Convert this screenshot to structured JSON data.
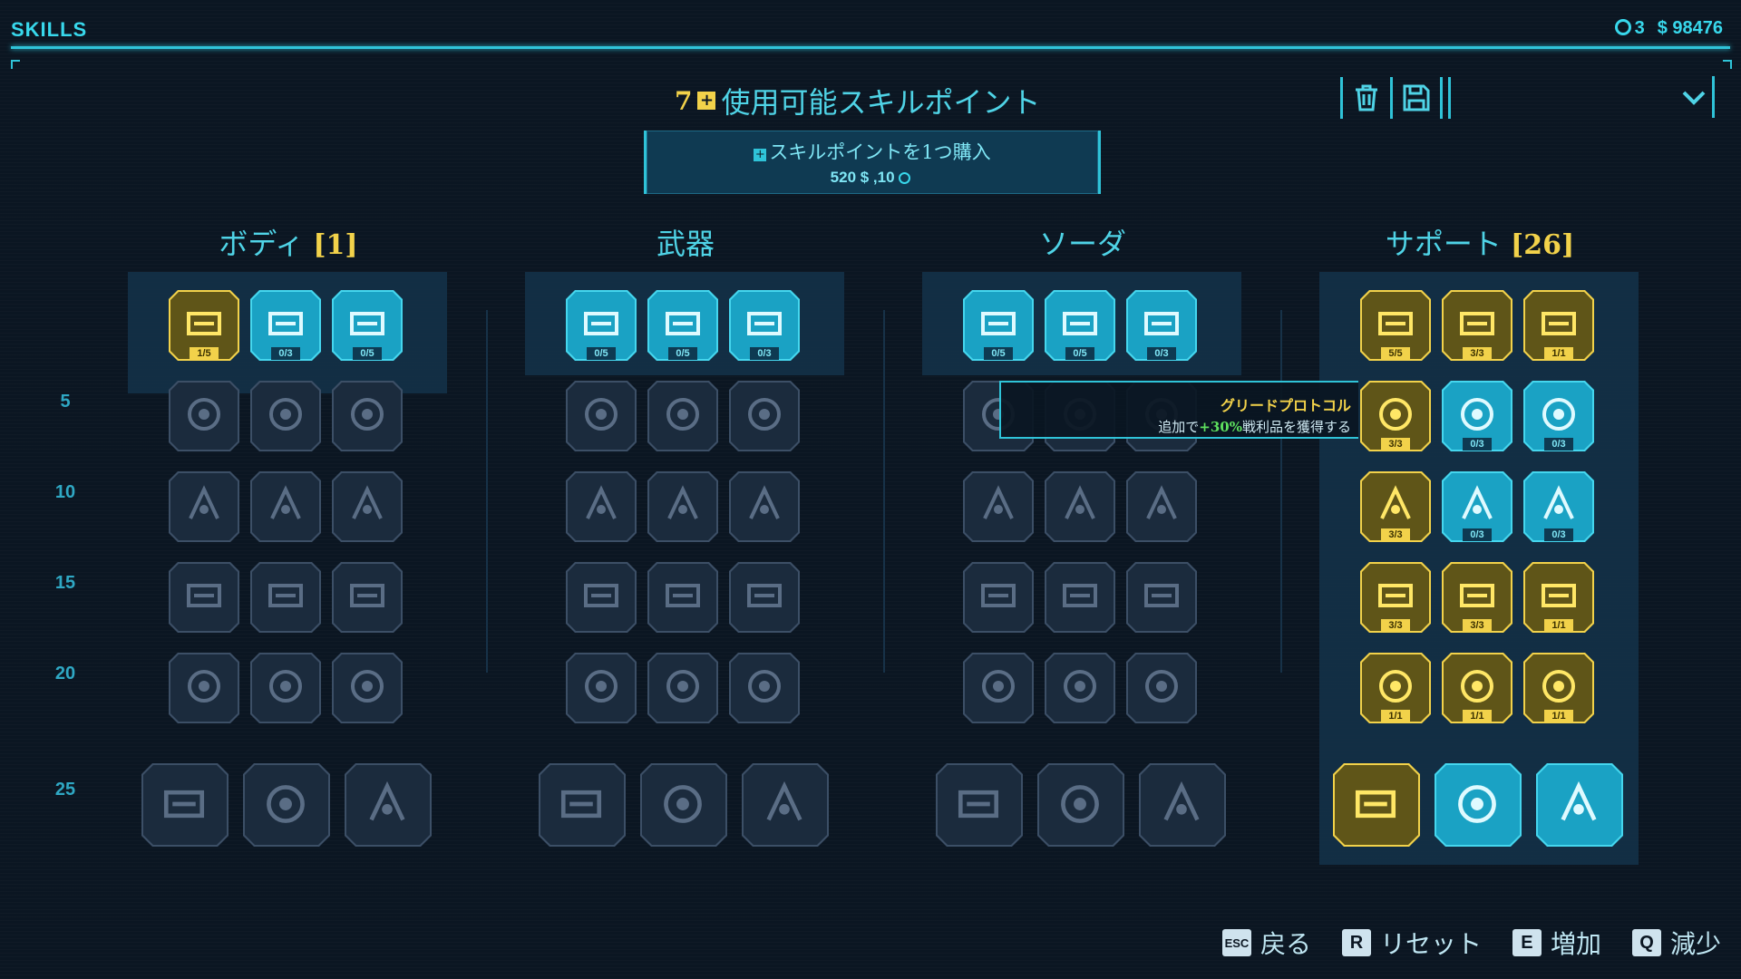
{
  "header": {
    "title": "SKILLS",
    "tokens": "3",
    "money": "98476"
  },
  "points": {
    "count": "7",
    "label": "使用可能スキルポイント"
  },
  "buy": {
    "label": "スキルポイントを1つ購入",
    "cost": "520 $ ,10"
  },
  "columns": [
    {
      "name": "ボディ",
      "bracket": "[1]"
    },
    {
      "name": "武器",
      "bracket": ""
    },
    {
      "name": "ソーダ",
      "bracket": ""
    },
    {
      "name": "サポート",
      "bracket": "[26]"
    }
  ],
  "row_labels": [
    "5",
    "10",
    "15",
    "20",
    "25"
  ],
  "badges": {
    "body_r0": [
      "1/5",
      "0/3",
      "0/5"
    ],
    "weapon_r0": [
      "0/5",
      "0/5",
      "0/3"
    ],
    "soda_r0": [
      "0/5",
      "0/5",
      "0/3"
    ],
    "support_r0": [
      "5/5",
      "3/3",
      "1/1"
    ],
    "support_r1": [
      "3/3",
      "0/3",
      "0/3"
    ],
    "support_r2": [
      "3/3",
      "0/3",
      "0/3"
    ],
    "support_r3": [
      "3/3",
      "3/3",
      "1/1"
    ],
    "support_r4": [
      "1/1",
      "1/1",
      "1/1"
    ]
  },
  "tooltip": {
    "title": "グリードプロトコル",
    "pre": "追加で",
    "highlight": "+30%",
    "post": "戦利品を獲得する"
  },
  "footer": [
    {
      "key": "ESC",
      "label": "戻る"
    },
    {
      "key": "R",
      "label": "リセット"
    },
    {
      "key": "E",
      "label": "増加"
    },
    {
      "key": "Q",
      "label": "減少"
    }
  ],
  "colors": {
    "accent": "#2fc3d8",
    "unlocked": "#f2d24a",
    "available": "#45d6ee",
    "locked": "#3c4f66"
  }
}
